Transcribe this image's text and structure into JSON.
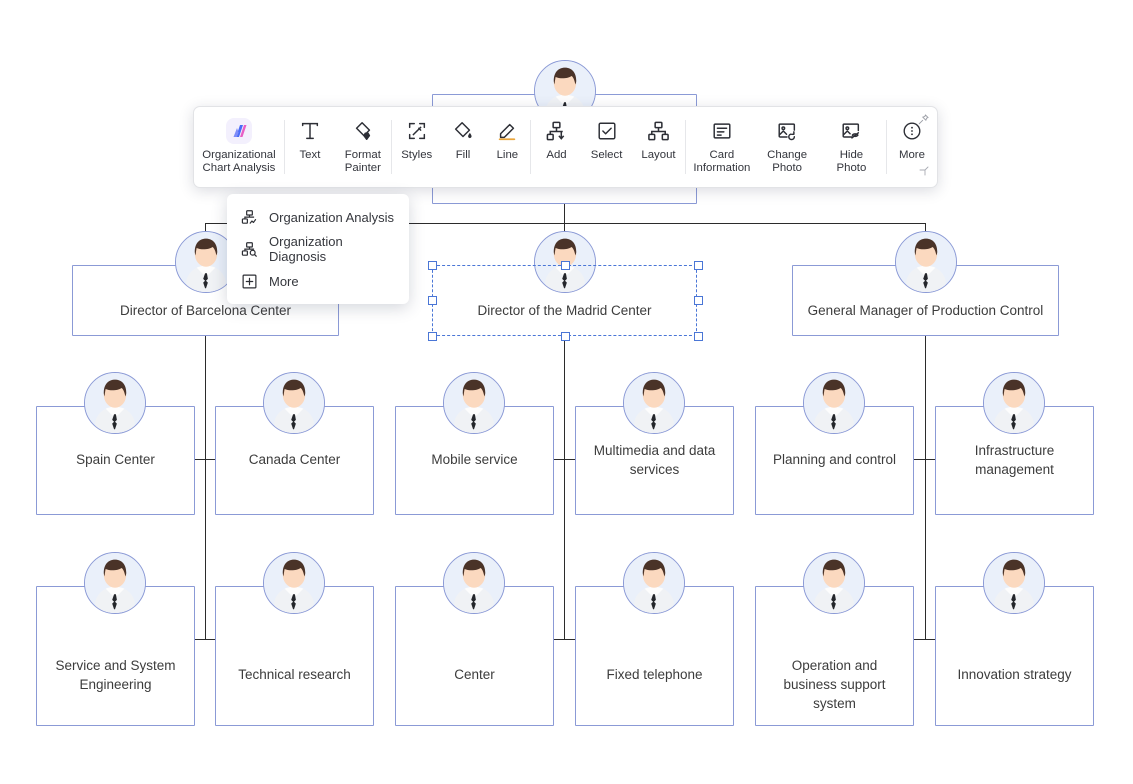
{
  "app": {
    "accent": "#8b9ad6",
    "selection_color": "#4a76d6",
    "connector_color": "#2b2b2b"
  },
  "toolbar": {
    "items": [
      {
        "label": "Organizational\nChart Analysis",
        "icon": "org-chart-analysis-icon"
      },
      {
        "label": "Text",
        "icon": "text-icon"
      },
      {
        "label": "Format\nPainter",
        "icon": "format-painter-icon"
      },
      {
        "label": "Styles",
        "icon": "styles-icon"
      },
      {
        "label": "Fill",
        "icon": "fill-icon"
      },
      {
        "label": "Line",
        "icon": "line-icon"
      },
      {
        "label": "Add",
        "icon": "add-node-icon"
      },
      {
        "label": "Select",
        "icon": "select-checkbox-icon"
      },
      {
        "label": "Layout",
        "icon": "layout-icon"
      },
      {
        "label": "Card\nInformation",
        "icon": "card-information-icon"
      },
      {
        "label": "Change\nPhoto",
        "icon": "change-photo-icon"
      },
      {
        "label": "Hide Photo",
        "icon": "hide-photo-icon"
      },
      {
        "label": "More",
        "icon": "more-icon"
      }
    ],
    "pin_icon": "pin-icon",
    "resize_icon": "resize-handle-icon"
  },
  "dropdown": {
    "items": [
      {
        "label": "Organization Analysis",
        "icon": "organization-analysis-icon"
      },
      {
        "label": "Organization Diagnosis",
        "icon": "organization-diagnosis-icon"
      },
      {
        "label": "More",
        "icon": "plus-box-icon"
      }
    ]
  },
  "chart": {
    "root": {
      "label": ""
    },
    "level2": [
      {
        "label": "Director of Barcelona Center",
        "selected": false
      },
      {
        "label": "Director of the Madrid Center",
        "selected": true
      },
      {
        "label": "General Manager of Production Control",
        "selected": false
      }
    ],
    "level3": [
      {
        "label": "Spain Center"
      },
      {
        "label": "Canada Center"
      },
      {
        "label": "Mobile service"
      },
      {
        "label": "Multimedia and data services"
      },
      {
        "label": "Planning and control"
      },
      {
        "label": "Infrastructure management"
      }
    ],
    "level4": [
      {
        "label": "Service and System Engineering"
      },
      {
        "label": "Technical research"
      },
      {
        "label": "Center"
      },
      {
        "label": "Fixed telephone"
      },
      {
        "label": "Operation and business support system"
      },
      {
        "label": "Innovation strategy"
      }
    ]
  }
}
